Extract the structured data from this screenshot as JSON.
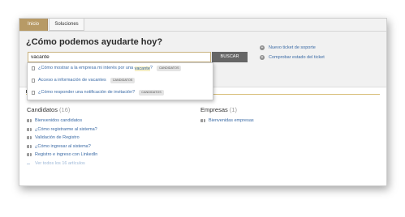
{
  "tabs": [
    {
      "label": "Inicio",
      "active": true
    },
    {
      "label": "Soluciones",
      "active": false
    }
  ],
  "hero": {
    "title": "¿Cómo podemos ayudarte hoy?",
    "search_value": "vacante",
    "search_button": "BUSCAR"
  },
  "side_links": [
    {
      "icon": "plus-icon",
      "label": "Nuevo ticket de soporte"
    },
    {
      "icon": "ticket-status-icon",
      "label": "Comprobar estado del ticket"
    }
  ],
  "suggestions": [
    {
      "before": "¿Cómo mostrar a la empresa mi interés por una ",
      "highlight": "vacante",
      "after": "?",
      "badge": "CANDIDATOS"
    },
    {
      "before": "Acceso a información de vacantes",
      "highlight": "",
      "after": "",
      "badge": "CANDIDATOS"
    },
    {
      "before": "¿Cómo responder una notificación de invitación?",
      "highlight": "",
      "after": "",
      "badge": "CANDIDATOS"
    }
  ],
  "candidatos": {
    "title": "Candidatos",
    "count": "(16)",
    "articles": [
      "Bienvenidos candidatos",
      "¿Cómo registrarme al sistema?",
      "Validación de Registro",
      "¿Cómo ingresar al sistema?",
      "Registro e ingreso con LinkedIn"
    ],
    "see_all": "Ver todos los 16 artículos"
  },
  "empresas": {
    "title": "Empresas",
    "count": "(1)",
    "articles": [
      "Bienvenidas empresas"
    ]
  },
  "colors": {
    "accent_tab": "#b79a66",
    "link": "#3a6aa5",
    "highlight": "#f4eec6",
    "button": "#666666"
  }
}
